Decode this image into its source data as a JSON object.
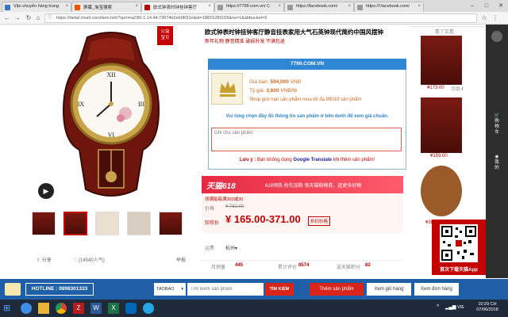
{
  "browser": {
    "tabs": [
      {
        "title": "Vận chuyển hàng trung",
        "active": false
      },
      {
        "title": "屏幕_淘宝搜索",
        "active": false
      },
      {
        "title": "欧式钟表时钟挂钟客厅",
        "active": true
      },
      {
        "title": "https://7799.com.vn/ C",
        "active": false
      },
      {
        "title": "https://facebook.com/",
        "active": false
      },
      {
        "title": "https://l.facebook.com/",
        "active": false
      }
    ],
    "url": "https://detail.tmall.com/item.htm?spm=a230r.1.14.44.73674b2eb9K61e&id=18831289155&ns=1&abbucket=6"
  },
  "product": {
    "badge_line1": "公益",
    "badge_line2": "宝贝",
    "title": "欧式钟表时钟挂钟客厅静音挂表家用大气石英钟现代简约中国风摆钟",
    "subtitle": "新年礼物 静音精准 破损补发 不满包退",
    "share": "分享",
    "favorites": "(14540人气)",
    "report": "举报",
    "tmall_logo": "天猫618",
    "promo": "618预热 抢先加购 领天猫购物券，逛更多好物",
    "coupon_line": "领满贴每满300减30",
    "price_label": "价格",
    "old_price": "¥ 762.00",
    "promo_label": "狂欢价",
    "price_range": "¥ 165.00-371.00",
    "price_tag": "折扣价格",
    "ship_label": "运费",
    "ship_value": "杭州▾",
    "monthly_label": "月销量",
    "monthly_value": "445",
    "reviews_label": "累计评价",
    "reviews_value": "8574",
    "points_label": "送天猫积分",
    "points_value": "82"
  },
  "popup": {
    "site": "7799.COM.VN",
    "price_label": "Giá bán:",
    "price_value": "594,000",
    "price_unit": "VNĐ",
    "rate_label": "Tỷ giá:",
    "rate_value": "3,600",
    "rate_unit": "VNĐ/tệ",
    "note": "Shop giới hạn sản phẩm mua tối đa 99019 sản phẩm",
    "instruction": "Vui lòng chọn đầy đủ thông tin sản phẩm ở bên dưới để xem giá chuẩn.",
    "notes_placeholder": "Ghi chú sản phẩm",
    "warning_prefix": "Lưu ý :",
    "warning_text1": "Bạn không dùng",
    "warning_link": "Google Translate",
    "warning_text2": "khi thêm sản phẩm!"
  },
  "sidebar": {
    "header": "看了又看",
    "items": [
      {
        "price": "¥173.00",
        "sold": "月销 4"
      },
      {
        "price": "¥159.00",
        "sold": ""
      },
      {
        "price": "¥388.00",
        "sold": ""
      }
    ],
    "qr_caption": "首次下载天猫App",
    "vertical_tabs": [
      "购物车",
      "我的"
    ]
  },
  "plugin": {
    "hotline_label": "HOTLINE : 0898301333",
    "source": "TAOBAO",
    "search_placeholder": "Tìm kiếm sản phẩm",
    "search_button": "TÌM KIẾM",
    "add_button": "Thêm sản phẩm",
    "cart_button": "Xem giỏ hàng",
    "orders_button": "Xem đơn hàng"
  },
  "taskbar": {
    "time": "10:29 CH",
    "date": "07/06/2018",
    "lang": "VIE"
  }
}
